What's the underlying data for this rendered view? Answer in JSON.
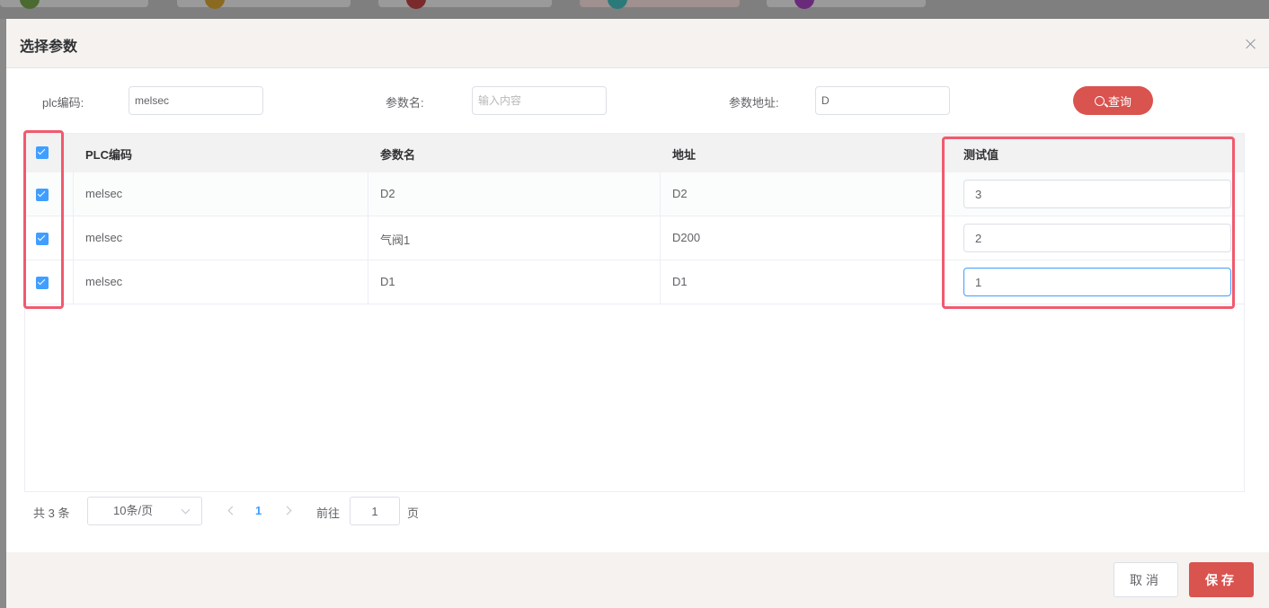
{
  "dialog": {
    "title": "选择参数"
  },
  "filters": {
    "plc_code_label": "plc编码:",
    "plc_code_value": "melsec",
    "param_name_label": "参数名:",
    "param_name_placeholder": "输入内容",
    "param_addr_label": "参数地址:",
    "param_addr_value": "D",
    "search_label": "查询"
  },
  "table": {
    "headers": {
      "plc_code": "PLC编码",
      "param_name": "参数名",
      "address": "地址",
      "test_value": "测试值"
    },
    "rows": [
      {
        "checked": true,
        "plc_code": "melsec",
        "param_name": "D2",
        "address": "D2",
        "test_value": "3"
      },
      {
        "checked": true,
        "plc_code": "melsec",
        "param_name": "气阀1",
        "address": "D200",
        "test_value": "2"
      },
      {
        "checked": true,
        "plc_code": "melsec",
        "param_name": "D1",
        "address": "D1",
        "test_value": "1"
      }
    ]
  },
  "pagination": {
    "total_text": "共 3 条",
    "page_size": "10条/页",
    "current_page": "1",
    "goto_label": "前往",
    "goto_value": "1",
    "goto_suffix": "页"
  },
  "footer": {
    "cancel_label": "取消",
    "save_label": "保存"
  },
  "colors": {
    "accent": "#d9534f",
    "checkbox": "#409eff",
    "highlight": "#f05a6e"
  }
}
